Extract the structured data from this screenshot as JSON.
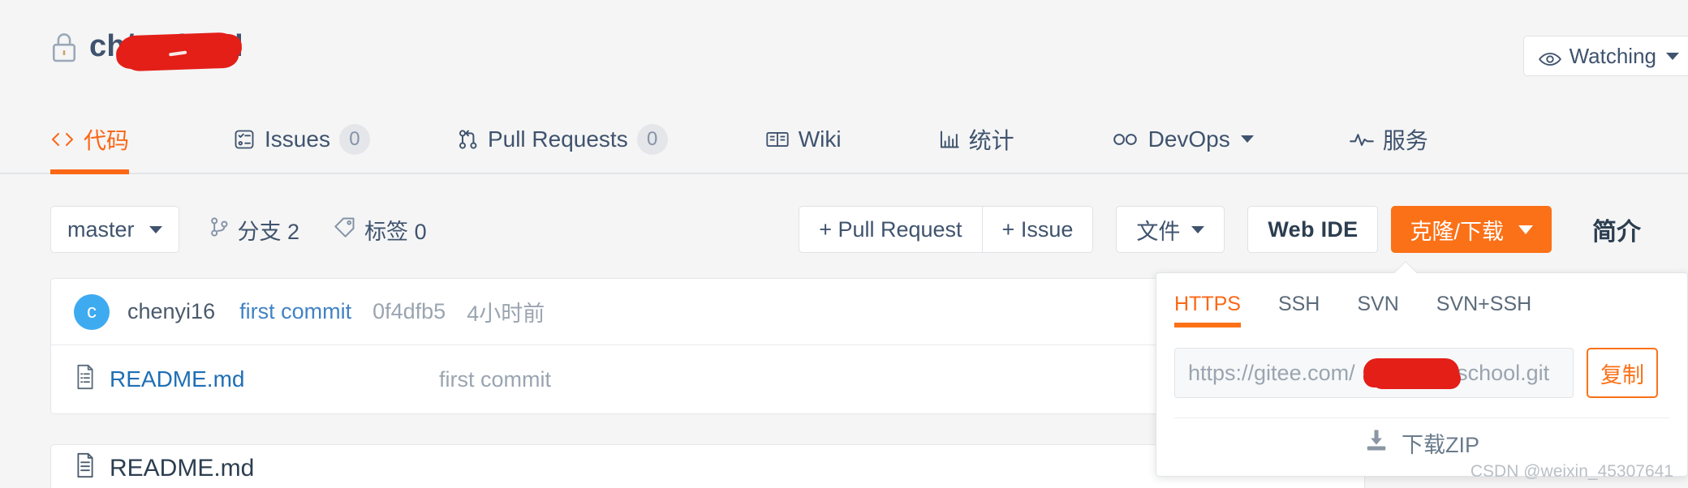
{
  "header": {
    "lock_icon": "lock-icon",
    "repo_owner_prefix": "ch",
    "repo_separator": "/",
    "repo_name": "school",
    "watching": {
      "icon": "eye-icon",
      "label": "Watching",
      "caret": "chevron-down-icon"
    }
  },
  "nav": {
    "tabs": [
      {
        "label": "代码",
        "icon": "code-icon",
        "badge": null,
        "active": true
      },
      {
        "label": "Issues",
        "icon": "issue-list-icon",
        "badge": "0",
        "active": false
      },
      {
        "label": "Pull Requests",
        "icon": "pull-request-icon",
        "badge": "0",
        "active": false
      },
      {
        "label": "Wiki",
        "icon": "book-icon",
        "badge": null,
        "active": false
      },
      {
        "label": "统计",
        "icon": "bar-chart-icon",
        "badge": null,
        "active": false
      },
      {
        "label": "DevOps",
        "icon": "infinity-icon",
        "badge": null,
        "active": false,
        "caret": true
      },
      {
        "label": "服务",
        "icon": "pulse-icon",
        "badge": null,
        "active": false
      }
    ]
  },
  "toolbar": {
    "branch": "master",
    "branch_caret": "chevron-down-icon",
    "branches_icon": "branch-icon",
    "branches_label": "分支 2",
    "tags_icon": "tag-icon",
    "tags_label": "标签 0",
    "pull_request_button": "+ Pull Request",
    "issue_button": "+ Issue",
    "file_button": "文件",
    "file_caret": "chevron-down-icon",
    "web_ide_button": "Web IDE",
    "clone_button": "克隆/下载",
    "clone_caret": "chevron-down-icon",
    "intro_label": "简介"
  },
  "commit": {
    "avatar_initial": "c",
    "author": "chenyi16",
    "message": "first commit",
    "sha": "0f4dfb5",
    "time": "4小时前"
  },
  "files": [
    {
      "icon": "file-markdown-icon",
      "name": "README.md",
      "commit_message": "first commit"
    }
  ],
  "readme_card": {
    "icon": "file-markdown-icon",
    "title": "README.md"
  },
  "clone_popover": {
    "protocol_tabs": [
      {
        "label": "HTTPS",
        "active": true
      },
      {
        "label": "SSH",
        "active": false
      },
      {
        "label": "SVN",
        "active": false
      },
      {
        "label": "SVN+SSH",
        "active": false
      }
    ],
    "url_prefix": "https://gitee.com/",
    "url_suffix": "/school.git",
    "copy_button": "复制",
    "download_icon": "download-icon",
    "download_label": "下载ZIP"
  },
  "watermark": "CSDN @weixin_45307641",
  "colors": {
    "accent_orange": "#fb6716",
    "clone_orange": "#fb7117",
    "text_dark": "#3f536e",
    "link_blue": "#4183c4",
    "muted": "#9aa5b1",
    "redaction_red": "#e31f18",
    "page_bg": "#f5f5f5"
  }
}
